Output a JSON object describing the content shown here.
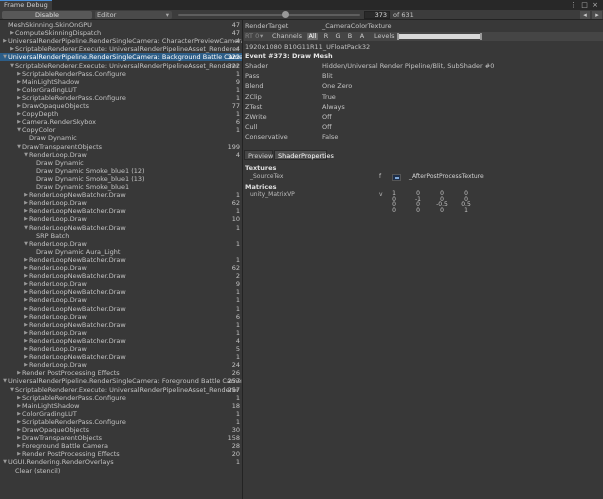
{
  "window": {
    "title": "Frame Debug",
    "menu": "⋮ □ ×"
  },
  "toolbar": {
    "disable_label": "Disable",
    "target_select": "Editor",
    "step_current": "373",
    "step_total": "of 631",
    "slider_fraction": 0.59
  },
  "tree": [
    {
      "level": 0,
      "arrow": "",
      "name": "MeshSkinning.SkinOnGPU",
      "count": "47"
    },
    {
      "level": 1,
      "arrow": "▶",
      "name": "ComputeSkinningDispatch",
      "count": "47"
    },
    {
      "level": 0,
      "arrow": "▶",
      "name": "UniversalRenderPipeline.RenderSingleCamera: CharacterPreviewCamera",
      "count": "4"
    },
    {
      "level": 1,
      "arrow": "▶",
      "name": "ScriptableRenderer.Execute: UniversalRenderPipelineAsset_Renderer",
      "count": "4"
    },
    {
      "level": 0,
      "arrow": "▼",
      "name": "UniversalRenderPipeline.RenderSingleCamera: Background Battle Camera",
      "count": "322",
      "selected": true
    },
    {
      "level": 1,
      "arrow": "▼",
      "name": "ScriptableRenderer.Execute: UniversalRenderPipelineAsset_Renderer",
      "count": "322"
    },
    {
      "level": 2,
      "arrow": "▶",
      "name": "ScriptableRenderPass.Configure",
      "count": "1"
    },
    {
      "level": 2,
      "arrow": "▶",
      "name": "MainLightShadow",
      "count": "9"
    },
    {
      "level": 2,
      "arrow": "▶",
      "name": "ColorGradingLUT",
      "count": "1"
    },
    {
      "level": 2,
      "arrow": "▶",
      "name": "ScriptableRenderPass.Configure",
      "count": "1"
    },
    {
      "level": 2,
      "arrow": "▶",
      "name": "DrawOpaqueObjects",
      "count": "77"
    },
    {
      "level": 2,
      "arrow": "▶",
      "name": "CopyDepth",
      "count": "1"
    },
    {
      "level": 2,
      "arrow": "▶",
      "name": "Camera.RenderSkybox",
      "count": "6"
    },
    {
      "level": 2,
      "arrow": "▼",
      "name": "CopyColor",
      "count": "1"
    },
    {
      "level": 3,
      "arrow": "",
      "name": "Draw Dynamic",
      "count": ""
    },
    {
      "level": 2,
      "arrow": "▼",
      "name": "DrawTransparentObjects",
      "count": "199"
    },
    {
      "level": 3,
      "arrow": "▼",
      "name": "RenderLoop.Draw",
      "count": "4"
    },
    {
      "level": 4,
      "arrow": "",
      "name": "Draw Dynamic",
      "count": ""
    },
    {
      "level": 4,
      "arrow": "",
      "name": "Draw Dynamic Smoke_blue1 (12)",
      "count": ""
    },
    {
      "level": 4,
      "arrow": "",
      "name": "Draw Dynamic Smoke_blue1 (13)",
      "count": ""
    },
    {
      "level": 4,
      "arrow": "",
      "name": "Draw Dynamic Smoke_blue1",
      "count": ""
    },
    {
      "level": 3,
      "arrow": "▶",
      "name": "RenderLoopNewBatcher.Draw",
      "count": "1"
    },
    {
      "level": 3,
      "arrow": "▶",
      "name": "RenderLoop.Draw",
      "count": "62"
    },
    {
      "level": 3,
      "arrow": "▶",
      "name": "RenderLoopNewBatcher.Draw",
      "count": "1"
    },
    {
      "level": 3,
      "arrow": "▶",
      "name": "RenderLoop.Draw",
      "count": "10"
    },
    {
      "level": 3,
      "arrow": "▼",
      "name": "RenderLoopNewBatcher.Draw",
      "count": "1"
    },
    {
      "level": 4,
      "arrow": "",
      "name": "SRP Batch",
      "count": ""
    },
    {
      "level": 3,
      "arrow": "▼",
      "name": "RenderLoop.Draw",
      "count": "1"
    },
    {
      "level": 4,
      "arrow": "",
      "name": "Draw Dynamic Aura_Light",
      "count": ""
    },
    {
      "level": 3,
      "arrow": "▶",
      "name": "RenderLoopNewBatcher.Draw",
      "count": "1"
    },
    {
      "level": 3,
      "arrow": "▶",
      "name": "RenderLoop.Draw",
      "count": "62"
    },
    {
      "level": 3,
      "arrow": "▶",
      "name": "RenderLoopNewBatcher.Draw",
      "count": "2"
    },
    {
      "level": 3,
      "arrow": "▶",
      "name": "RenderLoop.Draw",
      "count": "9"
    },
    {
      "level": 3,
      "arrow": "▶",
      "name": "RenderLoopNewBatcher.Draw",
      "count": "1"
    },
    {
      "level": 3,
      "arrow": "▶",
      "name": "RenderLoop.Draw",
      "count": "1"
    },
    {
      "level": 3,
      "arrow": "▶",
      "name": "RenderLoopNewBatcher.Draw",
      "count": "1"
    },
    {
      "level": 3,
      "arrow": "▶",
      "name": "RenderLoop.Draw",
      "count": "6"
    },
    {
      "level": 3,
      "arrow": "▶",
      "name": "RenderLoopNewBatcher.Draw",
      "count": "1"
    },
    {
      "level": 3,
      "arrow": "▶",
      "name": "RenderLoop.Draw",
      "count": "1"
    },
    {
      "level": 3,
      "arrow": "▶",
      "name": "RenderLoopNewBatcher.Draw",
      "count": "4"
    },
    {
      "level": 3,
      "arrow": "▶",
      "name": "RenderLoop.Draw",
      "count": "5"
    },
    {
      "level": 3,
      "arrow": "▶",
      "name": "RenderLoopNewBatcher.Draw",
      "count": "1"
    },
    {
      "level": 3,
      "arrow": "▶",
      "name": "RenderLoop.Draw",
      "count": "24"
    },
    {
      "level": 2,
      "arrow": "▶",
      "name": "Render PostProcessing Effects",
      "count": "26"
    },
    {
      "level": 0,
      "arrow": "▼",
      "name": "UniversalRenderPipeline.RenderSingleCamera: Foreground Battle Camera",
      "count": "257"
    },
    {
      "level": 1,
      "arrow": "▼",
      "name": "ScriptableRenderer.Execute: UniversalRenderPipelineAsset_Renderer",
      "count": "257"
    },
    {
      "level": 2,
      "arrow": "▶",
      "name": "ScriptableRenderPass.Configure",
      "count": "1"
    },
    {
      "level": 2,
      "arrow": "▶",
      "name": "MainLightShadow",
      "count": "18"
    },
    {
      "level": 2,
      "arrow": "▶",
      "name": "ColorGradingLUT",
      "count": "1"
    },
    {
      "level": 2,
      "arrow": "▶",
      "name": "ScriptableRenderPass.Configure",
      "count": "1"
    },
    {
      "level": 2,
      "arrow": "▶",
      "name": "DrawOpaqueObjects",
      "count": "30"
    },
    {
      "level": 2,
      "arrow": "▶",
      "name": "DrawTransparentObjects",
      "count": "158"
    },
    {
      "level": 2,
      "arrow": "▶",
      "name": "Foreground Battle Camera",
      "count": "28"
    },
    {
      "level": 2,
      "arrow": "▶",
      "name": "Render PostProcessing Effects",
      "count": "20"
    },
    {
      "level": 0,
      "arrow": "▼",
      "name": "UGUI.Rendering.RenderOverlays",
      "count": "1"
    },
    {
      "level": 1,
      "arrow": "",
      "name": "Clear (stencil)",
      "count": ""
    }
  ],
  "detail": {
    "render_target_label": "RenderTarget",
    "render_target_value": "_CameraColorTexture",
    "rt_dropdown": "RT 0",
    "channels_label": "Channels",
    "channels": [
      "All",
      "R",
      "G",
      "B",
      "A"
    ],
    "channels_active": "All",
    "levels_label": "Levels",
    "format": "1920x1080 B10G11R11_UFloatPack32",
    "event": "Event #373: Draw Mesh",
    "properties": [
      {
        "name": "Shader",
        "value": "Hidden/Universal Render Pipeline/Blit, SubShader #0"
      },
      {
        "name": "Pass",
        "value": "Blit"
      },
      {
        "name": "Blend",
        "value": "One Zero"
      },
      {
        "name": "ZClip",
        "value": "True"
      },
      {
        "name": "ZTest",
        "value": "Always"
      },
      {
        "name": "ZWrite",
        "value": "Off"
      },
      {
        "name": "Cull",
        "value": "Off"
      },
      {
        "name": "Conservative",
        "value": "False"
      }
    ],
    "tabs": [
      "Preview",
      "ShaderProperties"
    ],
    "active_tab": "ShaderProperties",
    "textures_header": "Textures",
    "texture": {
      "name": "_SourceTex",
      "stage": "f",
      "value": "_AfterPostProcessTexture"
    },
    "matrices_header": "Matrices",
    "matrix": {
      "name": "unity_MatrixVP",
      "stage": "v",
      "rows": [
        [
          "1",
          "0",
          "0",
          "0"
        ],
        [
          "0",
          "-1",
          "0",
          "0"
        ],
        [
          "0",
          "0",
          "-0.5",
          "0.5"
        ],
        [
          "0",
          "0",
          "0",
          "1"
        ]
      ]
    }
  }
}
